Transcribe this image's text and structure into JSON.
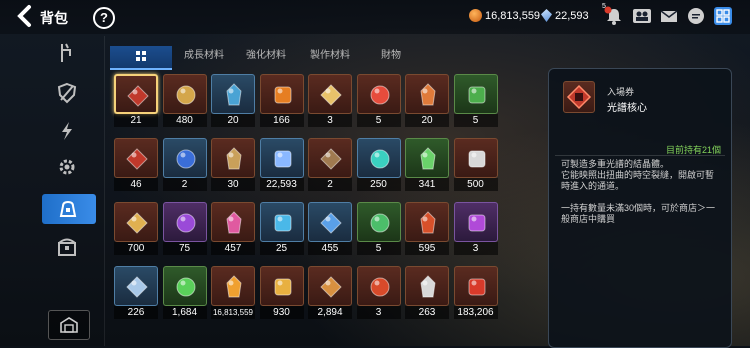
{
  "header": {
    "title": "背包",
    "gold": "16,813,559",
    "crystal": "22,593",
    "notification_badge": "5"
  },
  "tabs": [
    {
      "label": "",
      "icon": "grid-icon"
    },
    {
      "label": "成長材料"
    },
    {
      "label": "強化材料"
    },
    {
      "label": "製作材料"
    },
    {
      "label": "財物"
    }
  ],
  "items": [
    {
      "count": "21",
      "color": "#c0392b"
    },
    {
      "count": "480",
      "color": "#d4a64a"
    },
    {
      "count": "20",
      "color": "#4aa3d4"
    },
    {
      "count": "166",
      "color": "#e67e22"
    },
    {
      "count": "3",
      "color": "#e8c26a"
    },
    {
      "count": "5",
      "color": "#e74c3c"
    },
    {
      "count": "20",
      "color": "#e07a3a"
    },
    {
      "count": "5",
      "color": "#4cae4c"
    },
    {
      "count": "46",
      "color": "#c0392b"
    },
    {
      "count": "2",
      "color": "#3a6ed8"
    },
    {
      "count": "30",
      "color": "#c9a05a"
    },
    {
      "count": "22,593",
      "color": "#8ab8ff"
    },
    {
      "count": "2",
      "color": "#a07a50"
    },
    {
      "count": "250",
      "color": "#3ad0c0"
    },
    {
      "count": "341",
      "color": "#6ad26a"
    },
    {
      "count": "500",
      "color": "#d8d8d8"
    },
    {
      "count": "700",
      "color": "#e0b050"
    },
    {
      "count": "75",
      "color": "#9a4ad8"
    },
    {
      "count": "457",
      "color": "#e05aa0"
    },
    {
      "count": "25",
      "color": "#4ab8e8"
    },
    {
      "count": "455",
      "color": "#5aa0e8"
    },
    {
      "count": "5",
      "color": "#4cbe6a"
    },
    {
      "count": "595",
      "color": "#d8502a"
    },
    {
      "count": "3",
      "color": "#b04ad8"
    },
    {
      "count": "226",
      "color": "#a8c8e8"
    },
    {
      "count": "1,684",
      "color": "#5ad05a"
    },
    {
      "count": "16,813,559",
      "color": "#f0a030"
    },
    {
      "count": "930",
      "color": "#e8b040"
    },
    {
      "count": "2,894",
      "color": "#d89040"
    },
    {
      "count": "3",
      "color": "#d84a2a"
    },
    {
      "count": "263",
      "color": "#d8d8d8"
    },
    {
      "count": "183,206",
      "color": "#d83a2a"
    }
  ],
  "detail": {
    "category": "入場券",
    "name": "光譜核心",
    "owned": "目前持有21個",
    "desc_lines": [
      "可製造多重光譜的結晶體。",
      "它能映照出扭曲的時空裂縫，開啟可暫",
      "時進入的通道。",
      "",
      "一持有數量未滿30個時，可於商店＞一",
      "般商店中購買"
    ]
  }
}
